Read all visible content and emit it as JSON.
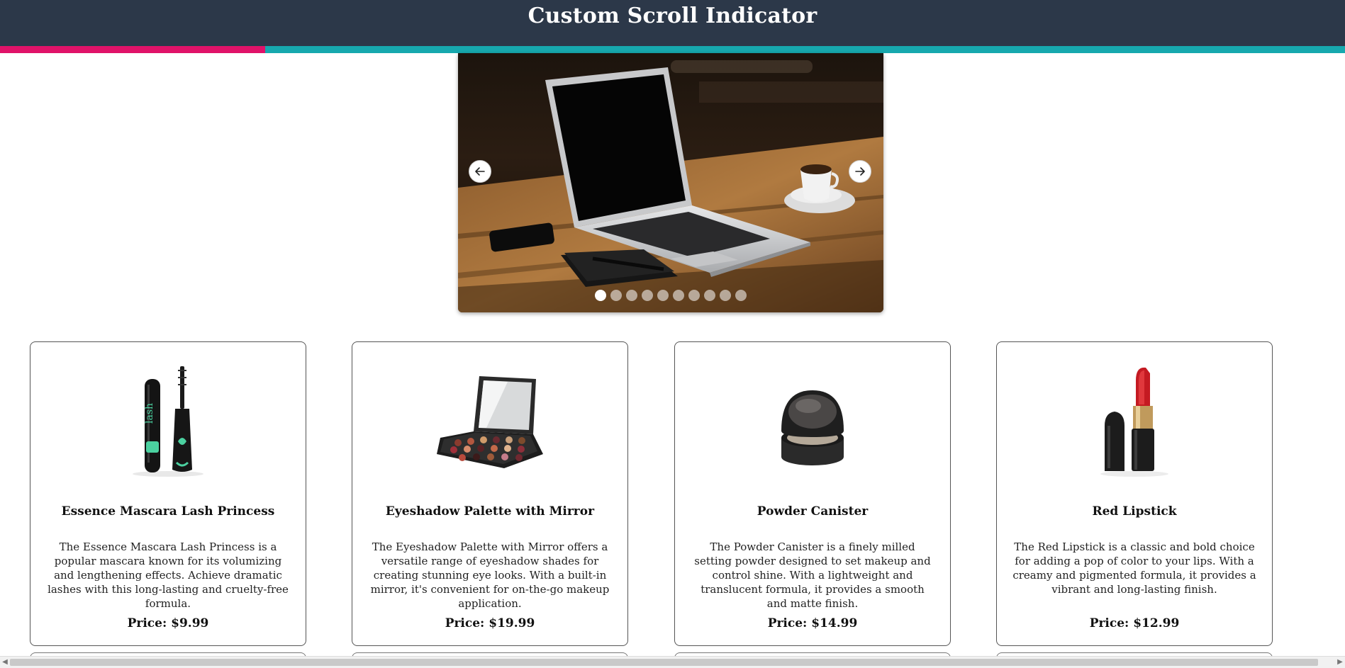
{
  "header": {
    "title": "Custom Scroll Indicator",
    "scroll_progress": 0.197,
    "colors": {
      "background": "#2c3849",
      "progress_fill": "#e01269",
      "progress_track": "#17a8ae"
    }
  },
  "carousel": {
    "prev_icon": "arrow-left-icon",
    "next_icon": "arrow-right-icon",
    "slide_count": 10,
    "active_index": 0
  },
  "products": [
    {
      "name": "Essence Mascara Lash Princess",
      "description": "The Essence Mascara Lash Princess is a popular mascara known for its volumizing and lengthening effects. Achieve dramatic lashes with this long-lasting and cruelty-free formula.",
      "price": "Price: $9.99",
      "icon": "mascara-image"
    },
    {
      "name": "Eyeshadow Palette with Mirror",
      "description": "The Eyeshadow Palette with Mirror offers a versatile range of eyeshadow shades for creating stunning eye looks. With a built-in mirror, it's convenient for on-the-go makeup application.",
      "price": "Price: $19.99",
      "icon": "eyeshadow-palette-image"
    },
    {
      "name": "Powder Canister",
      "description": "The Powder Canister is a finely milled setting powder designed to set makeup and control shine. With a lightweight and translucent formula, it provides a smooth and matte finish.",
      "price": "Price: $14.99",
      "icon": "powder-canister-image"
    },
    {
      "name": "Red Lipstick",
      "description": "The Red Lipstick is a classic and bold choice for adding a pop of color to your lips. With a creamy and pigmented formula, it provides a vibrant and long-lasting finish.",
      "price": "Price: $12.99",
      "icon": "lipstick-image"
    }
  ]
}
